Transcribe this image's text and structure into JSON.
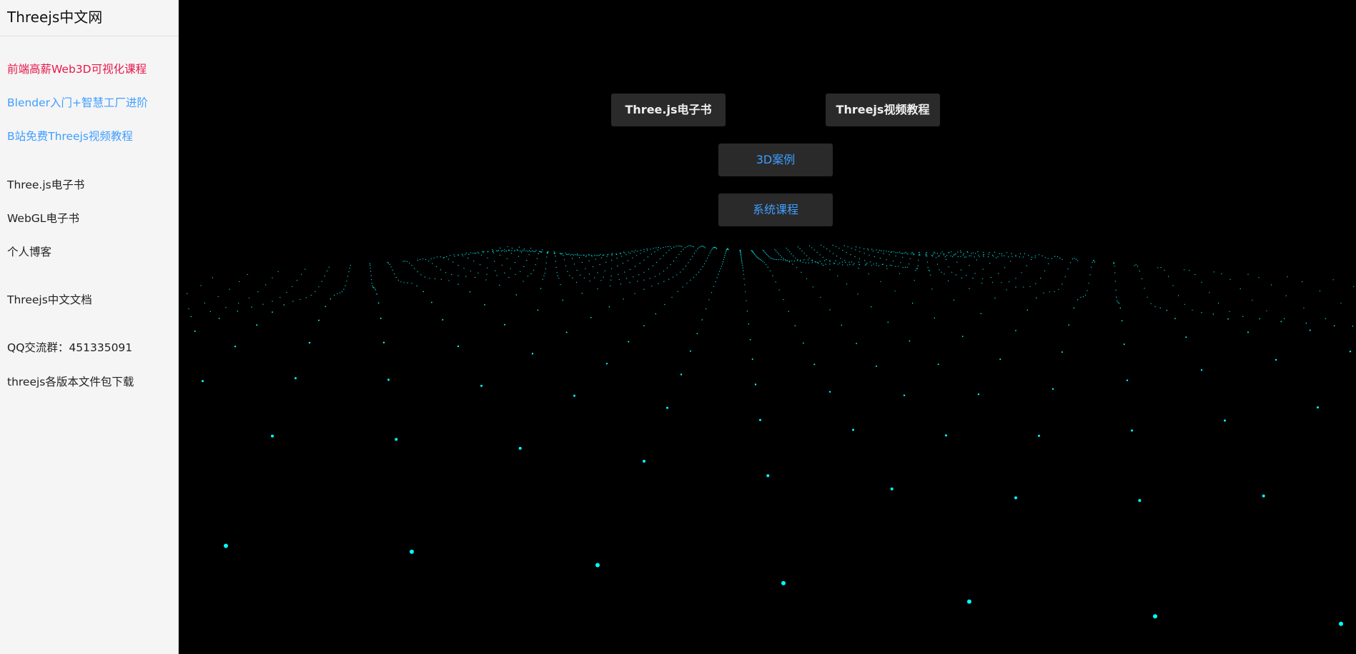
{
  "sidebar": {
    "title": "Threejs中文网",
    "links": [
      {
        "label": "前端高薪Web3D可视化课程",
        "style": "red"
      },
      {
        "label": "Blender入门+智慧工厂进阶",
        "style": "blue"
      },
      {
        "label": "B站免费Threejs视频教程",
        "style": "blue"
      },
      {
        "label": "Three.js电子书",
        "style": "plain"
      },
      {
        "label": "WebGL电子书",
        "style": "plain"
      },
      {
        "label": "个人博客",
        "style": "plain"
      },
      {
        "label": "Threejs中文文档",
        "style": "plain"
      },
      {
        "label": "QQ交流群：451335091",
        "style": "plain"
      },
      {
        "label": "threejs各版本文件包下载",
        "style": "plain"
      }
    ]
  },
  "scene": {
    "buttons": {
      "ebook": "Three.js电子书",
      "video": "Threejs视频教程",
      "cases": "3D案例",
      "courses": "系统课程"
    },
    "particle_color": "#00ffff"
  },
  "colors": {
    "sidebar_bg": "#f5f5f5",
    "link_red": "#e8184b",
    "link_blue": "#409eff",
    "button_bg": "#2a2a2a"
  }
}
